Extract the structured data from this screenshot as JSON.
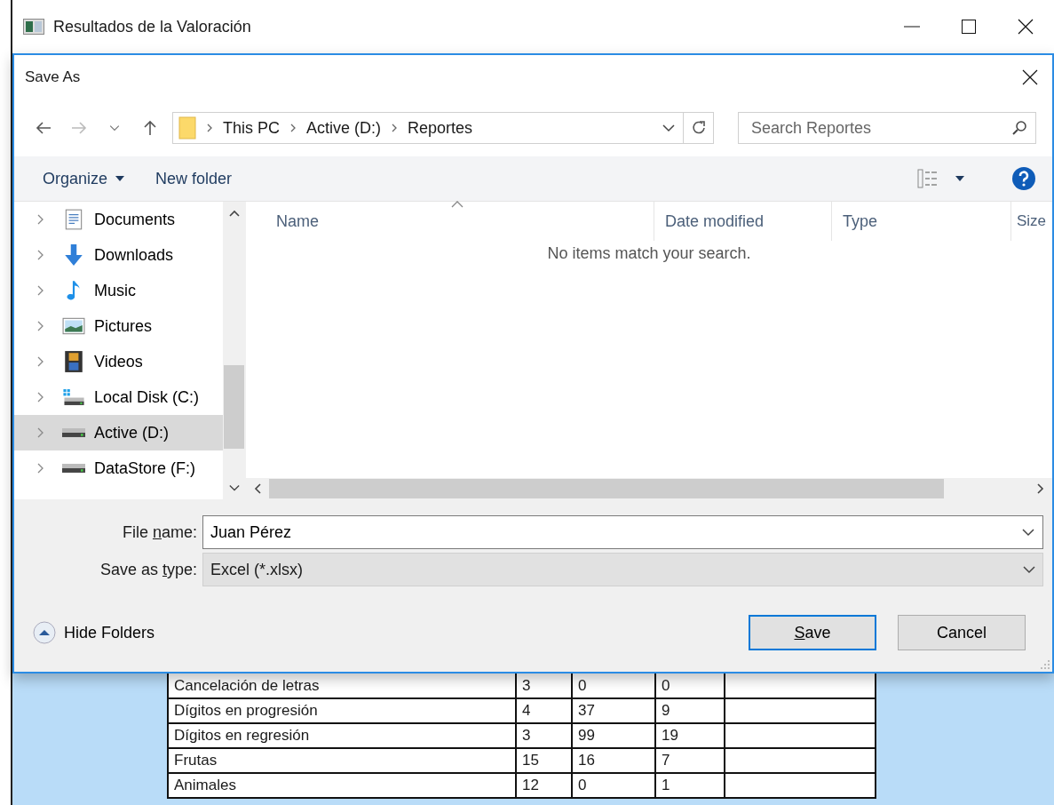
{
  "window": {
    "title": "Resultados de la Valoración"
  },
  "dialog": {
    "title": "Save As",
    "breadcrumb": [
      "This PC",
      "Active (D:)",
      "Reportes"
    ],
    "search": {
      "placeholder": "Search Reportes"
    },
    "toolbar": {
      "organize": "Organize",
      "new_folder": "New folder"
    },
    "nav_items": [
      {
        "label": "Documents",
        "kind": "documents",
        "selected": false
      },
      {
        "label": "Downloads",
        "kind": "downloads",
        "selected": false
      },
      {
        "label": "Music",
        "kind": "music",
        "selected": false
      },
      {
        "label": "Pictures",
        "kind": "pictures",
        "selected": false
      },
      {
        "label": "Videos",
        "kind": "videos",
        "selected": false
      },
      {
        "label": "Local Disk (C:)",
        "kind": "system-drive",
        "selected": false
      },
      {
        "label": "Active (D:)",
        "kind": "drive",
        "selected": true
      },
      {
        "label": "DataStore (F:)",
        "kind": "drive",
        "selected": false
      }
    ],
    "columns": [
      "Name",
      "Date modified",
      "Type",
      "Size"
    ],
    "empty_message": "No items match your search.",
    "file_name": {
      "label_before": "File ",
      "access_key": "n",
      "label_after": "ame:",
      "value": "Juan Pérez"
    },
    "save_type": {
      "label_before": "Save as ",
      "access_key": "t",
      "label_after": "ype:",
      "value": "Excel (*.xlsx)"
    },
    "hide_folders": "Hide Folders",
    "buttons": [
      {
        "access_key": "S",
        "label_after": "ave",
        "default": true
      },
      {
        "label_before": "Cancel",
        "default": false
      }
    ]
  },
  "table": {
    "rows": [
      [
        "Cancelación de letras",
        "3",
        "0",
        "0"
      ],
      [
        "Dígitos en progresión",
        "4",
        "37",
        "9"
      ],
      [
        "Dígitos en regresión",
        "3",
        "99",
        "19"
      ],
      [
        "Frutas",
        "15",
        "16",
        "7"
      ],
      [
        "Animales",
        "12",
        "0",
        "1"
      ]
    ]
  }
}
